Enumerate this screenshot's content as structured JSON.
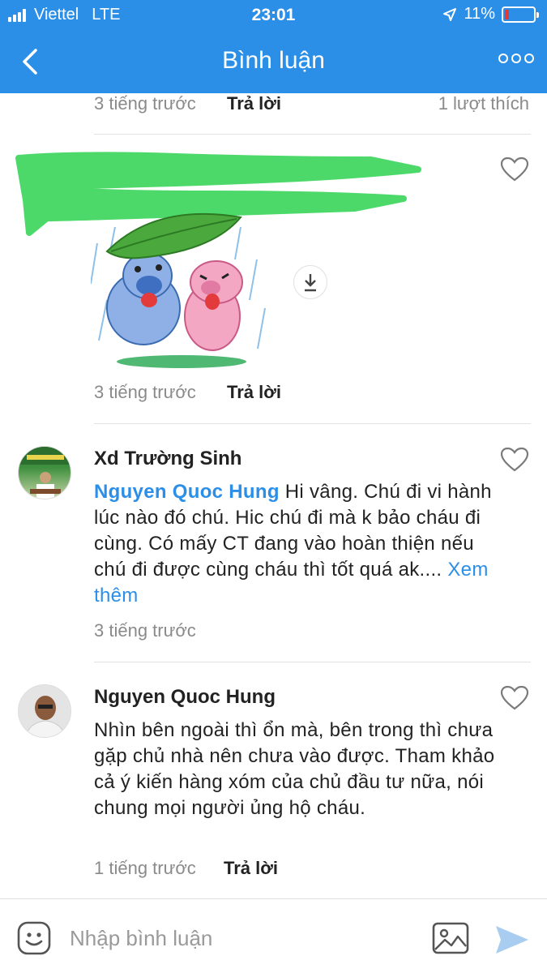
{
  "status_bar": {
    "carrier": "Viettel",
    "network": "LTE",
    "time": "23:01",
    "battery": "11%",
    "battery_color": "#e53935"
  },
  "header": {
    "title": "Bình luận",
    "back_icon": "chevron-left-icon",
    "more_icon": "more-icon",
    "color": "#2b8fe8"
  },
  "comments": [
    {
      "time": "3 tiếng trước",
      "reply_label": "Trả lời",
      "likes": "1 lượt thích"
    },
    {
      "time": "3 tiếng trước",
      "reply_label": "Trả lời",
      "sticker": "rain-leaf-pigs-sticker"
    },
    {
      "author": "Xd Trường Sinh",
      "mention": "Nguyen Quoc Hung",
      "text": " Hi vâng. Chú đi vi hành lúc nào đó chú. Hic chú đi mà k bảo cháu đi cùng. Có mấy CT đang vào hoàn thiện nếu chú đi được cùng cháu thì tốt quá ak.... ",
      "see_more": "Xem thêm",
      "time": "3 tiếng trước"
    },
    {
      "author": "Nguyen Quoc Hung",
      "text": "Nhìn bên ngoài thì ổn mà, bên trong thì chưa gặp chủ nhà nên chưa vào được. Tham khảo cả ý kiến hàng xóm của chủ đầu tư nữa, nói chung mọi người ủng hộ cháu.",
      "time": "1 tiếng trước",
      "reply_label": "Trả lời"
    }
  ],
  "input_bar": {
    "placeholder": "Nhập bình luận",
    "emoji_icon": "emoji-icon",
    "image_icon": "image-icon",
    "send_icon": "send-icon"
  }
}
